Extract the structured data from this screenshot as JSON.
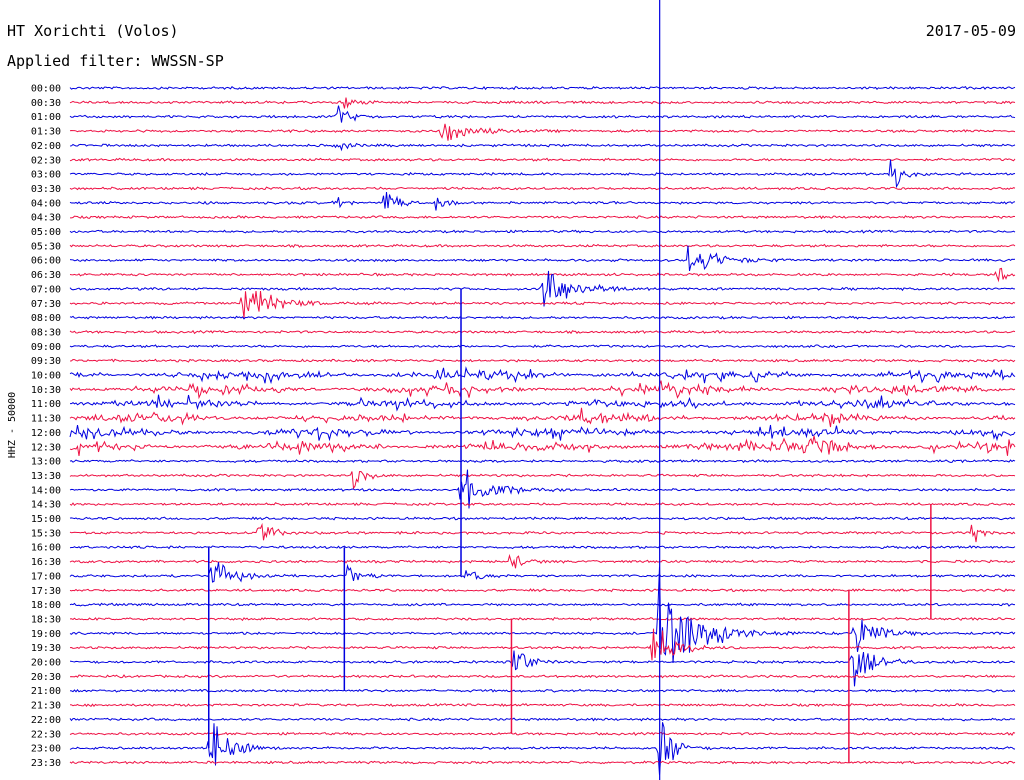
{
  "header": {
    "station": "HT Xorichti (Volos)",
    "date": "2017-05-09",
    "filter": "Applied filter: WWSSN-SP"
  },
  "chart_data": {
    "type": "line",
    "title": "HT Xorichti (Volos)",
    "ylabel": "HHZ - 50000",
    "x_range_minutes": [
      0,
      30
    ],
    "trace_colors": [
      "#0000e0",
      "#ee1144"
    ],
    "marker_color": "#0000e0",
    "marker_minute": 18.7,
    "y_tick_labels": [
      "00:00",
      "00:30",
      "01:00",
      "01:30",
      "02:00",
      "02:30",
      "03:00",
      "03:30",
      "04:00",
      "04:30",
      "05:00",
      "05:30",
      "06:00",
      "06:30",
      "07:00",
      "07:30",
      "08:00",
      "08:30",
      "09:00",
      "09:30",
      "10:00",
      "10:30",
      "11:00",
      "11:30",
      "12:00",
      "12:30",
      "13:00",
      "13:30",
      "14:00",
      "14:30",
      "15:00",
      "15:30",
      "16:00",
      "16:30",
      "17:00",
      "17:30",
      "18:00",
      "18:30",
      "19:00",
      "19:30",
      "20:00",
      "20:30",
      "21:00",
      "21:30",
      "22:00",
      "22:30",
      "23:00",
      "23:30"
    ],
    "events": [
      {
        "row": 1,
        "minute": 8.7,
        "amp": 0.5,
        "decay": 0.6
      },
      {
        "row": 2,
        "minute": 8.5,
        "amp": 0.7,
        "decay": 0.7
      },
      {
        "row": 3,
        "minute": 11.8,
        "amp": 1.0,
        "decay": 1.2
      },
      {
        "row": 4,
        "minute": 8.5,
        "amp": 0.35,
        "decay": 0.6
      },
      {
        "row": 6,
        "minute": 26.0,
        "amp": 1.6,
        "decay": 0.5
      },
      {
        "row": 8,
        "minute": 10.0,
        "amp": 1.5,
        "decay": 0.5
      },
      {
        "row": 8,
        "minute": 11.6,
        "amp": 0.8,
        "decay": 0.5
      },
      {
        "row": 8,
        "minute": 8.4,
        "amp": 0.5,
        "decay": 0.4
      },
      {
        "row": 12,
        "minute": 19.6,
        "amp": 1.3,
        "decay": 1.3
      },
      {
        "row": 13,
        "minute": 29.4,
        "amp": 0.6,
        "decay": 0.6
      },
      {
        "row": 14,
        "minute": 15.0,
        "amp": 2.4,
        "decay": 1.3
      },
      {
        "row": 15,
        "minute": 5.5,
        "amp": 1.6,
        "decay": 1.3
      },
      {
        "row": 27,
        "minute": 9.0,
        "amp": 1.1,
        "decay": 0.5
      },
      {
        "row": 25,
        "minute": 23.5,
        "amp": 1.0,
        "decay": 1.3
      },
      {
        "row": 28,
        "minute": 12.4,
        "amp": 1.5,
        "decay": 1.3
      },
      {
        "row": 31,
        "minute": 6.0,
        "amp": 1.0,
        "decay": 0.6
      },
      {
        "row": 31,
        "minute": 28.6,
        "amp": 0.8,
        "decay": 0.5
      },
      {
        "row": 33,
        "minute": 14.0,
        "amp": 1.0,
        "decay": 0.5
      },
      {
        "row": 34,
        "minute": 4.5,
        "amp": 1.4,
        "decay": 1.0
      },
      {
        "row": 34,
        "minute": 8.8,
        "amp": 1.2,
        "decay": 0.5
      },
      {
        "row": 34,
        "minute": 12.6,
        "amp": 0.8,
        "decay": 0.5
      },
      {
        "row": 38,
        "minute": 18.7,
        "amp": 5.0,
        "decay": 1.5
      },
      {
        "row": 38,
        "minute": 24.9,
        "amp": 2.2,
        "decay": 0.9
      },
      {
        "row": 39,
        "minute": 18.5,
        "amp": 2.0,
        "decay": 1.0
      },
      {
        "row": 40,
        "minute": 14.1,
        "amp": 1.3,
        "decay": 0.6
      },
      {
        "row": 40,
        "minute": 24.8,
        "amp": 1.8,
        "decay": 0.9
      },
      {
        "row": 46,
        "minute": 4.4,
        "amp": 2.6,
        "decay": 0.9
      },
      {
        "row": 46,
        "minute": 18.7,
        "amp": 2.4,
        "decay": 0.6
      }
    ],
    "noisy_rows": [
      20,
      21,
      22,
      23,
      24,
      25
    ],
    "spikes": [
      {
        "row": 14,
        "minute": 12.4,
        "span_rows": 20
      },
      {
        "row": 29,
        "minute": 27.3,
        "span_rows": 8
      },
      {
        "row": 32,
        "minute": 4.4,
        "span_rows": 14
      },
      {
        "row": 32,
        "minute": 8.7,
        "span_rows": 10
      },
      {
        "row": 35,
        "minute": 24.7,
        "span_rows": 12
      },
      {
        "row": 37,
        "minute": 14.0,
        "span_rows": 8
      }
    ]
  }
}
